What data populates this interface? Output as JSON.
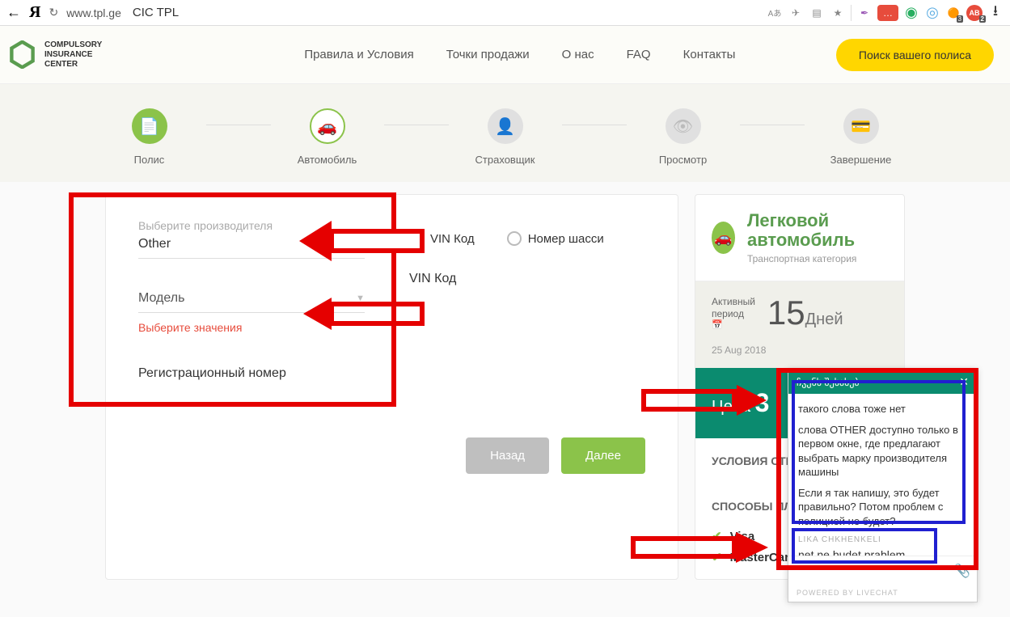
{
  "browser": {
    "url": "www.tpl.ge",
    "title": "CIC TPL",
    "translate_badge": "Aあ"
  },
  "logo": {
    "line1": "COMPULSORY",
    "line2": "INSURANCE",
    "line3": "CENTER"
  },
  "nav": [
    "Правила и Условия",
    "Точки продажи",
    "О нас",
    "FAQ",
    "Контакты"
  ],
  "search_btn": "Поиск вашего полиса",
  "steps": [
    {
      "label": "Полис",
      "icon": "file-icon"
    },
    {
      "label": "Автомобиль",
      "icon": "car-icon"
    },
    {
      "label": "Страховщик",
      "icon": "person-icon"
    },
    {
      "label": "Просмотр",
      "icon": "eye-icon"
    },
    {
      "label": "Завершение",
      "icon": "card-icon"
    }
  ],
  "form": {
    "manufacturer_label": "Выберите производителя",
    "manufacturer_value": "Other",
    "model_label": "Модель",
    "model_error": "Выберите значения",
    "reg_label": "Регистрационный номер",
    "radio_vin": "VIN Код",
    "radio_chassis": "Номер шасси",
    "vin_field": "VIN Код",
    "btn_back": "Назад",
    "btn_next": "Далее"
  },
  "sidebar": {
    "title": "Легковой автомобиль",
    "subtitle": "Транспортная категория",
    "period_label": "Активный\nпериод",
    "days_num": "15",
    "days_txt": "Дней",
    "date": "25 Aug 2018",
    "price_label": "Цена",
    "price_num": "3",
    "cond_title": "УСЛОВИЯ СТРАХ",
    "pay_title": "СПОСОБЫ ПЛАТ",
    "pay": [
      "Visa",
      "MasterCard"
    ]
  },
  "chat": {
    "header": "ჩვენს შესახებ",
    "msg1": "такого слова тоже нет",
    "msg2": "слова OTHER доступно только в первом окне, где предлагают выбрать марку производителя машины",
    "msg3": "Если я так напишу, это будет правильно? Потом проблем с полицией не будет?",
    "agent_name": "LIKA CHKHENKELI",
    "agent_msg": "net ne budet prablem.",
    "footer": "POWERED BY LIVECHAT",
    "attach_title": "Attach"
  },
  "ext_badges": {
    "red_dots": "…",
    "orange_num": "3",
    "abp_num": "2"
  }
}
